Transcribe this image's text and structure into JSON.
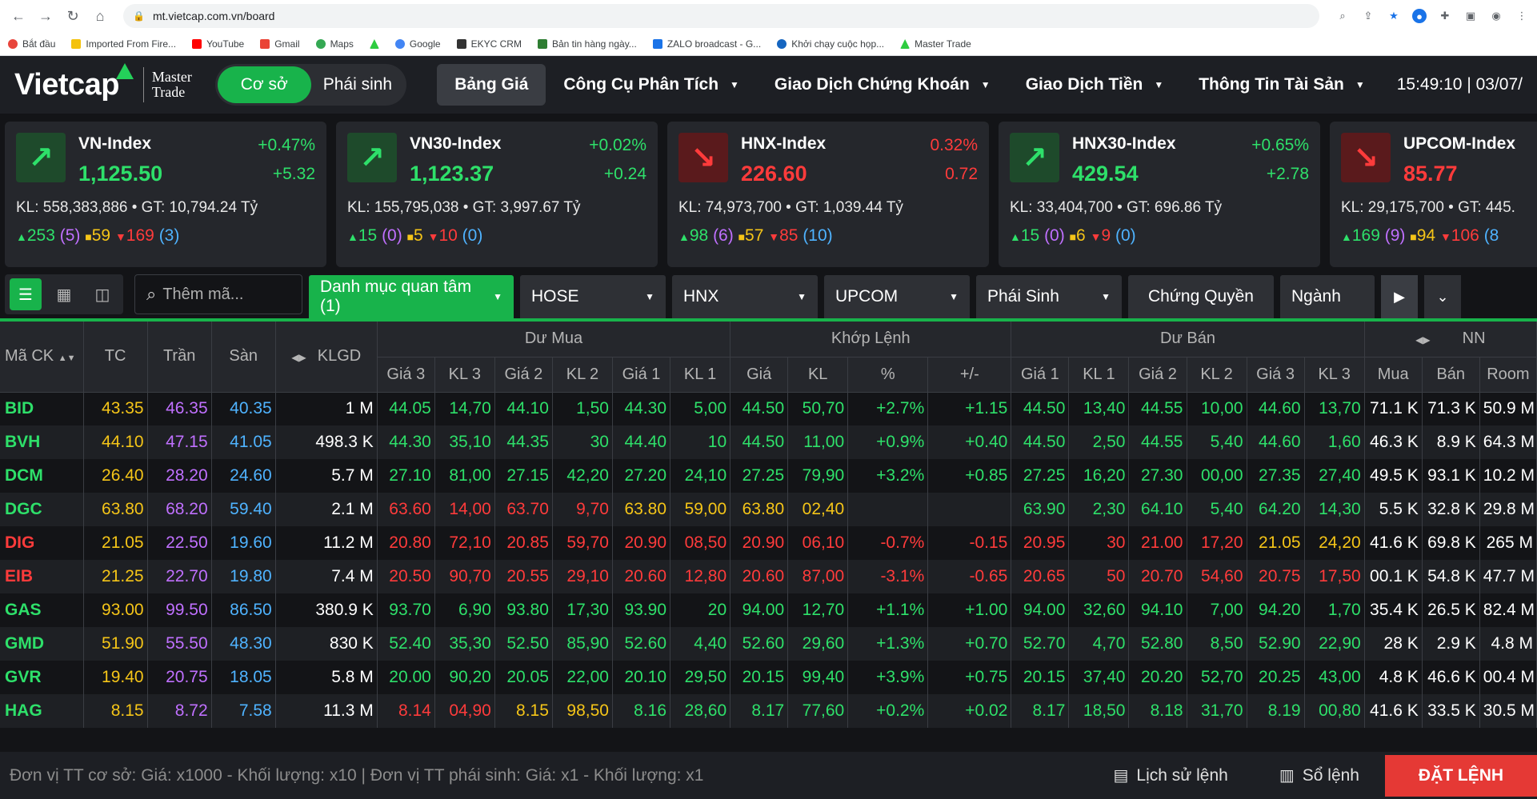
{
  "browser": {
    "url": "mt.vietcap.com.vn/board",
    "bookmarks": [
      "Bắt đầu",
      "Imported From Fire...",
      "YouTube",
      "Gmail",
      "Maps",
      "",
      "Google",
      "EKYC CRM",
      "Bản tin hàng ngày...",
      "ZALO broadcast - G...",
      "Khởi chạy cuộc họp...",
      "Master Trade"
    ]
  },
  "header": {
    "logo": "Vietcap",
    "logo_sub_1": "Master",
    "logo_sub_2": "Trade",
    "seg_left": "Cơ sở",
    "seg_right": "Phái sinh",
    "menu": [
      "Bảng Giá",
      "Công Cụ Phân Tích",
      "Giao Dịch Chứng Khoán",
      "Giao Dịch Tiền",
      "Thông Tin Tài Sản"
    ],
    "clock": "15:49:10 | 03/07/"
  },
  "indices": [
    {
      "name": "VN-Index",
      "value": "1,125.50",
      "pct": "+0.47%",
      "chg": "+5.32",
      "dir": "up",
      "kl": "KL: 558,383,886 • GT: 10,794.24 Tỷ",
      "up": "253",
      "up_ceil": "(5)",
      "flat": "59",
      "down": "169",
      "down_floor": "(3)"
    },
    {
      "name": "VN30-Index",
      "value": "1,123.37",
      "pct": "+0.02%",
      "chg": "+0.24",
      "dir": "up",
      "kl": "KL: 155,795,038 • GT: 3,997.67 Tỷ",
      "up": "15",
      "up_ceil": "(0)",
      "flat": "5",
      "down": "10",
      "down_floor": "(0)"
    },
    {
      "name": "HNX-Index",
      "value": "226.60",
      "pct": "0.32%",
      "chg": "0.72",
      "dir": "down",
      "kl": "KL: 74,973,700 • GT: 1,039.44 Tỷ",
      "up": "98",
      "up_ceil": "(6)",
      "flat": "57",
      "down": "85",
      "down_floor": "(10)"
    },
    {
      "name": "HNX30-Index",
      "value": "429.54",
      "pct": "+0.65%",
      "chg": "+2.78",
      "dir": "up",
      "kl": "KL: 33,404,700 • GT: 696.86 Tỷ",
      "up": "15",
      "up_ceil": "(0)",
      "flat": "6",
      "down": "9",
      "down_floor": "(0)"
    },
    {
      "name": "UPCOM-Index",
      "value": "85.77",
      "pct": "",
      "chg": "",
      "dir": "down",
      "kl": "KL: 29,175,700 • GT: 445.",
      "up": "169",
      "up_ceil": "(9)",
      "flat": "94",
      "down": "106",
      "down_floor": "(8"
    }
  ],
  "toolbar": {
    "search_placeholder": "Thêm mã...",
    "watchlist": "Danh mục quan tâm (1)",
    "hose": "HOSE",
    "hnx": "HNX",
    "upcom": "UPCOM",
    "phaisinh": "Phái Sinh",
    "chungquyen": "Chứng Quyền",
    "nganh": "Ngành"
  },
  "table": {
    "headers": {
      "mack": "Mã CK",
      "tc": "TC",
      "tran": "Trần",
      "san": "Sàn",
      "klgd": "KLGD",
      "dumua": "Dư Mua",
      "khoplenh": "Khớp Lệnh",
      "duban": "Dư Bán",
      "nn": "NN",
      "sub": [
        "Giá 3",
        "KL 3",
        "Giá 2",
        "KL 2",
        "Giá 1",
        "KL 1",
        "Giá",
        "KL",
        "%",
        "+/-",
        "Giá 1",
        "KL 1",
        "Giá 2",
        "KL 2",
        "Giá 3",
        "KL 3",
        "Mua",
        "Bán",
        "Room"
      ]
    },
    "rows": [
      {
        "sym": "BID",
        "c": "g",
        "tc": "43.35",
        "tran": "46.35",
        "san": "40.35",
        "klgd": "1 M",
        "cells": [
          [
            "44.05",
            "g"
          ],
          [
            "14,70",
            "g"
          ],
          [
            "44.10",
            "g"
          ],
          [
            "1,50",
            "g"
          ],
          [
            "44.30",
            "g"
          ],
          [
            "5,00",
            "g"
          ],
          [
            "44.50",
            "g"
          ],
          [
            "50,70",
            "g"
          ],
          [
            "+2.7%",
            "g"
          ],
          [
            "+1.15",
            "g"
          ],
          [
            "44.50",
            "g"
          ],
          [
            "13,40",
            "g"
          ],
          [
            "44.55",
            "g"
          ],
          [
            "10,00",
            "g"
          ],
          [
            "44.60",
            "g"
          ],
          [
            "13,70",
            "g"
          ],
          [
            "71.1 K",
            "w"
          ],
          [
            "71.3 K",
            "w"
          ],
          [
            "50.9 M",
            "w"
          ]
        ]
      },
      {
        "sym": "BVH",
        "c": "g",
        "tc": "44.10",
        "tran": "47.15",
        "san": "41.05",
        "klgd": "498.3 K",
        "cells": [
          [
            "44.30",
            "g"
          ],
          [
            "35,10",
            "g"
          ],
          [
            "44.35",
            "g"
          ],
          [
            "30",
            "g"
          ],
          [
            "44.40",
            "g"
          ],
          [
            "10",
            "g"
          ],
          [
            "44.50",
            "g"
          ],
          [
            "11,00",
            "g"
          ],
          [
            "+0.9%",
            "g"
          ],
          [
            "+0.40",
            "g"
          ],
          [
            "44.50",
            "g"
          ],
          [
            "2,50",
            "g"
          ],
          [
            "44.55",
            "g"
          ],
          [
            "5,40",
            "g"
          ],
          [
            "44.60",
            "g"
          ],
          [
            "1,60",
            "g"
          ],
          [
            "46.3 K",
            "w"
          ],
          [
            "8.9 K",
            "w"
          ],
          [
            "64.3 M",
            "w"
          ]
        ]
      },
      {
        "sym": "DCM",
        "c": "g",
        "tc": "26.40",
        "tran": "28.20",
        "san": "24.60",
        "klgd": "5.7 M",
        "cells": [
          [
            "27.10",
            "g"
          ],
          [
            "81,00",
            "g"
          ],
          [
            "27.15",
            "g"
          ],
          [
            "42,20",
            "g"
          ],
          [
            "27.20",
            "g"
          ],
          [
            "24,10",
            "g"
          ],
          [
            "27.25",
            "g"
          ],
          [
            "79,90",
            "g"
          ],
          [
            "+3.2%",
            "g"
          ],
          [
            "+0.85",
            "g"
          ],
          [
            "27.25",
            "g"
          ],
          [
            "16,20",
            "g"
          ],
          [
            "27.30",
            "g"
          ],
          [
            "00,00",
            "g"
          ],
          [
            "27.35",
            "g"
          ],
          [
            "27,40",
            "g"
          ],
          [
            "49.5 K",
            "w"
          ],
          [
            "93.1 K",
            "w"
          ],
          [
            "10.2 M",
            "w"
          ]
        ]
      },
      {
        "sym": "DGC",
        "c": "g",
        "tc": "63.80",
        "tran": "68.20",
        "san": "59.40",
        "klgd": "2.1 M",
        "cells": [
          [
            "63.60",
            "r"
          ],
          [
            "14,00",
            "r"
          ],
          [
            "63.70",
            "r"
          ],
          [
            "9,70",
            "r"
          ],
          [
            "63.80",
            "y"
          ],
          [
            "59,00",
            "y"
          ],
          [
            "63.80",
            "y"
          ],
          [
            "02,40",
            "y"
          ],
          [
            "",
            "y"
          ],
          [
            "",
            "y"
          ],
          [
            "63.90",
            "g"
          ],
          [
            "2,30",
            "g"
          ],
          [
            "64.10",
            "g"
          ],
          [
            "5,40",
            "g"
          ],
          [
            "64.20",
            "g"
          ],
          [
            "14,30",
            "g"
          ],
          [
            "5.5 K",
            "w"
          ],
          [
            "32.8 K",
            "w"
          ],
          [
            "29.8 M",
            "w"
          ]
        ]
      },
      {
        "sym": "DIG",
        "c": "r",
        "tc": "21.05",
        "tran": "22.50",
        "san": "19.60",
        "klgd": "11.2 M",
        "cells": [
          [
            "20.80",
            "r"
          ],
          [
            "72,10",
            "r"
          ],
          [
            "20.85",
            "r"
          ],
          [
            "59,70",
            "r"
          ],
          [
            "20.90",
            "r"
          ],
          [
            "08,50",
            "r"
          ],
          [
            "20.90",
            "r"
          ],
          [
            "06,10",
            "r"
          ],
          [
            "-0.7%",
            "r"
          ],
          [
            "-0.15",
            "r"
          ],
          [
            "20.95",
            "r"
          ],
          [
            "30",
            "r"
          ],
          [
            "21.00",
            "r"
          ],
          [
            "17,20",
            "r"
          ],
          [
            "21.05",
            "y"
          ],
          [
            "24,20",
            "y"
          ],
          [
            "41.6 K",
            "w"
          ],
          [
            "69.8 K",
            "w"
          ],
          [
            "265 M",
            "w"
          ]
        ]
      },
      {
        "sym": "EIB",
        "c": "r",
        "tc": "21.25",
        "tran": "22.70",
        "san": "19.80",
        "klgd": "7.4 M",
        "cells": [
          [
            "20.50",
            "r"
          ],
          [
            "90,70",
            "r"
          ],
          [
            "20.55",
            "r"
          ],
          [
            "29,10",
            "r"
          ],
          [
            "20.60",
            "r"
          ],
          [
            "12,80",
            "r"
          ],
          [
            "20.60",
            "r"
          ],
          [
            "87,00",
            "r"
          ],
          [
            "-3.1%",
            "r"
          ],
          [
            "-0.65",
            "r"
          ],
          [
            "20.65",
            "r"
          ],
          [
            "50",
            "r"
          ],
          [
            "20.70",
            "r"
          ],
          [
            "54,60",
            "r"
          ],
          [
            "20.75",
            "r"
          ],
          [
            "17,50",
            "r"
          ],
          [
            "00.1 K",
            "w"
          ],
          [
            "54.8 K",
            "w"
          ],
          [
            "47.7 M",
            "w"
          ]
        ]
      },
      {
        "sym": "GAS",
        "c": "g",
        "tc": "93.00",
        "tran": "99.50",
        "san": "86.50",
        "klgd": "380.9 K",
        "cells": [
          [
            "93.70",
            "g"
          ],
          [
            "6,90",
            "g"
          ],
          [
            "93.80",
            "g"
          ],
          [
            "17,30",
            "g"
          ],
          [
            "93.90",
            "g"
          ],
          [
            "20",
            "g"
          ],
          [
            "94.00",
            "g"
          ],
          [
            "12,70",
            "g"
          ],
          [
            "+1.1%",
            "g"
          ],
          [
            "+1.00",
            "g"
          ],
          [
            "94.00",
            "g"
          ],
          [
            "32,60",
            "g"
          ],
          [
            "94.10",
            "g"
          ],
          [
            "7,00",
            "g"
          ],
          [
            "94.20",
            "g"
          ],
          [
            "1,70",
            "g"
          ],
          [
            "35.4 K",
            "w"
          ],
          [
            "26.5 K",
            "w"
          ],
          [
            "82.4 M",
            "w"
          ]
        ]
      },
      {
        "sym": "GMD",
        "c": "g",
        "tc": "51.90",
        "tran": "55.50",
        "san": "48.30",
        "klgd": "830 K",
        "cells": [
          [
            "52.40",
            "g"
          ],
          [
            "35,30",
            "g"
          ],
          [
            "52.50",
            "g"
          ],
          [
            "85,90",
            "g"
          ],
          [
            "52.60",
            "g"
          ],
          [
            "4,40",
            "g"
          ],
          [
            "52.60",
            "g"
          ],
          [
            "29,60",
            "g"
          ],
          [
            "+1.3%",
            "g"
          ],
          [
            "+0.70",
            "g"
          ],
          [
            "52.70",
            "g"
          ],
          [
            "4,70",
            "g"
          ],
          [
            "52.80",
            "g"
          ],
          [
            "8,50",
            "g"
          ],
          [
            "52.90",
            "g"
          ],
          [
            "22,90",
            "g"
          ],
          [
            "28 K",
            "w"
          ],
          [
            "2.9 K",
            "w"
          ],
          [
            "4.8 M",
            "w"
          ]
        ]
      },
      {
        "sym": "GVR",
        "c": "g",
        "tc": "19.40",
        "tran": "20.75",
        "san": "18.05",
        "klgd": "5.8 M",
        "cells": [
          [
            "20.00",
            "g"
          ],
          [
            "90,20",
            "g"
          ],
          [
            "20.05",
            "g"
          ],
          [
            "22,00",
            "g"
          ],
          [
            "20.10",
            "g"
          ],
          [
            "29,50",
            "g"
          ],
          [
            "20.15",
            "g"
          ],
          [
            "99,40",
            "g"
          ],
          [
            "+3.9%",
            "g"
          ],
          [
            "+0.75",
            "g"
          ],
          [
            "20.15",
            "g"
          ],
          [
            "37,40",
            "g"
          ],
          [
            "20.20",
            "g"
          ],
          [
            "52,70",
            "g"
          ],
          [
            "20.25",
            "g"
          ],
          [
            "43,00",
            "g"
          ],
          [
            "4.8 K",
            "w"
          ],
          [
            "46.6 K",
            "w"
          ],
          [
            "00.4 M",
            "w"
          ]
        ]
      },
      {
        "sym": "HAG",
        "c": "g",
        "tc": "8.15",
        "tran": "8.72",
        "san": "7.58",
        "klgd": "11.3 M",
        "cells": [
          [
            "8.14",
            "r"
          ],
          [
            "04,90",
            "r"
          ],
          [
            "8.15",
            "y"
          ],
          [
            "98,50",
            "y"
          ],
          [
            "8.16",
            "g"
          ],
          [
            "28,60",
            "g"
          ],
          [
            "8.17",
            "g"
          ],
          [
            "77,60",
            "g"
          ],
          [
            "+0.2%",
            "g"
          ],
          [
            "+0.02",
            "g"
          ],
          [
            "8.17",
            "g"
          ],
          [
            "18,50",
            "g"
          ],
          [
            "8.18",
            "g"
          ],
          [
            "31,70",
            "g"
          ],
          [
            "8.19",
            "g"
          ],
          [
            "00,80",
            "g"
          ],
          [
            "41.6 K",
            "w"
          ],
          [
            "33.5 K",
            "w"
          ],
          [
            "30.5 M",
            "w"
          ]
        ]
      }
    ]
  },
  "footer": {
    "note": "Đơn vị TT cơ sở: Giá: x1000 - Khối lượng: x10 | Đơn vị TT phái sinh: Giá: x1 - Khối lượng: x1",
    "history": "Lịch sử lệnh",
    "orderbook": "Sổ lệnh",
    "place_order": "ĐẶT LỆNH"
  }
}
